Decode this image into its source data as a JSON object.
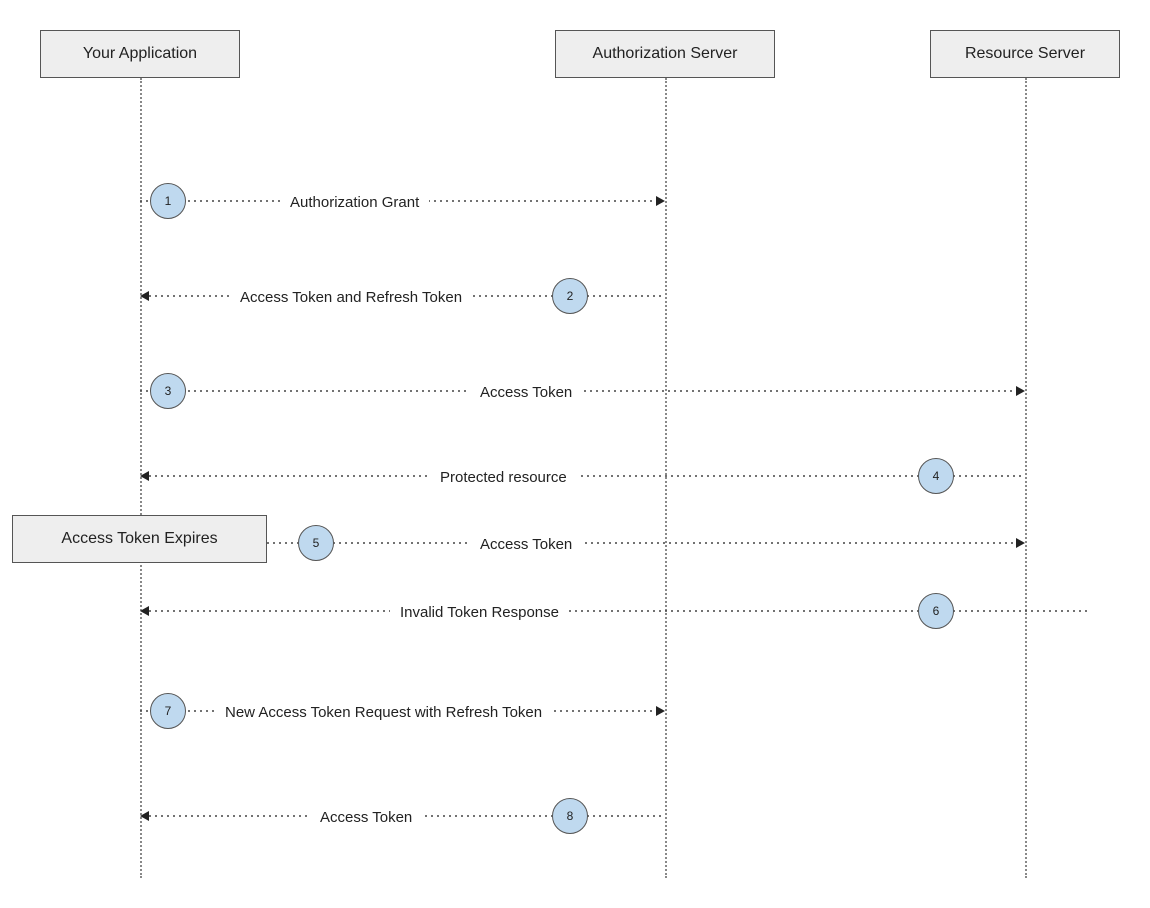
{
  "participants": {
    "app": "Your Application",
    "auth": "Authorization Server",
    "resource": "Resource Server"
  },
  "note": {
    "expires": "Access Token Expires"
  },
  "steps": {
    "s1": {
      "num": "1",
      "label": "Authorization Grant"
    },
    "s2": {
      "num": "2",
      "label": "Access Token and Refresh Token"
    },
    "s3": {
      "num": "3",
      "label": "Access Token"
    },
    "s4": {
      "num": "4",
      "label": "Protected resource"
    },
    "s5": {
      "num": "5",
      "label": "Access Token"
    },
    "s6": {
      "num": "6",
      "label": "Invalid Token Response"
    },
    "s7": {
      "num": "7",
      "label": "New Access Token Request with Refresh Token"
    },
    "s8": {
      "num": "8",
      "label": "Access Token"
    }
  }
}
